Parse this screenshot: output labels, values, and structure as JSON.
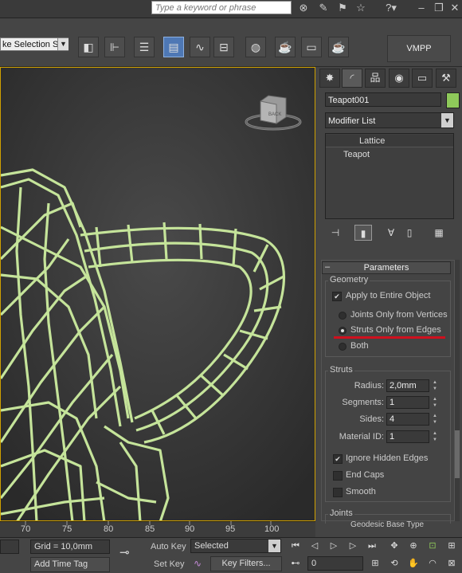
{
  "top_bar": {
    "search_placeholder": "Type a keyword or phrase",
    "icons": [
      "binoculars-icon",
      "wrench-icon",
      "star-icon",
      "help-icon",
      "minimize-icon",
      "restore-icon",
      "close-icon"
    ]
  },
  "toolbar": {
    "selection_set": "ke Selection Se",
    "vmpp_label": "VMPP"
  },
  "command_panel": {
    "object_name": "Teapot001",
    "object_color": "#8ec95a",
    "modifier_list": "Modifier List",
    "stack": [
      "Lattice",
      "Teapot"
    ]
  },
  "parameters": {
    "rollout_title": "Parameters",
    "geometry": {
      "label": "Geometry",
      "apply_entire": "Apply to Entire Object",
      "apply_entire_checked": true,
      "options": [
        {
          "label": "Joints Only from Vertices",
          "selected": false
        },
        {
          "label": "Struts Only from Edges",
          "selected": true
        },
        {
          "label": "Both",
          "selected": false
        }
      ]
    },
    "struts": {
      "label": "Struts",
      "fields": [
        {
          "label": "Radius:",
          "value": "2,0mm"
        },
        {
          "label": "Segments:",
          "value": "1"
        },
        {
          "label": "Sides:",
          "value": "4"
        },
        {
          "label": "Material ID:",
          "value": "1"
        }
      ],
      "checks": [
        {
          "label": "Ignore Hidden Edges",
          "checked": true
        },
        {
          "label": "End Caps",
          "checked": false
        },
        {
          "label": "Smooth",
          "checked": false
        }
      ]
    },
    "joints": {
      "label": "Joints",
      "base_type": "Geodesic Base Type"
    }
  },
  "viewcube": {
    "face": "BACK"
  },
  "timeline": {
    "ticks": [
      "70",
      "75",
      "80",
      "85",
      "90",
      "95",
      "100"
    ]
  },
  "bottom": {
    "grid": "Grid = 10,0mm",
    "add_time_tag": "Add Time Tag",
    "auto_key": "Auto Key",
    "set_key": "Set Key",
    "selected": "Selected",
    "key_filters": "Key Filters...",
    "frame": "0"
  },
  "colors": {
    "wire": "#c5e49a",
    "accent": "#4e78b5",
    "annotation": "#d0101e"
  }
}
